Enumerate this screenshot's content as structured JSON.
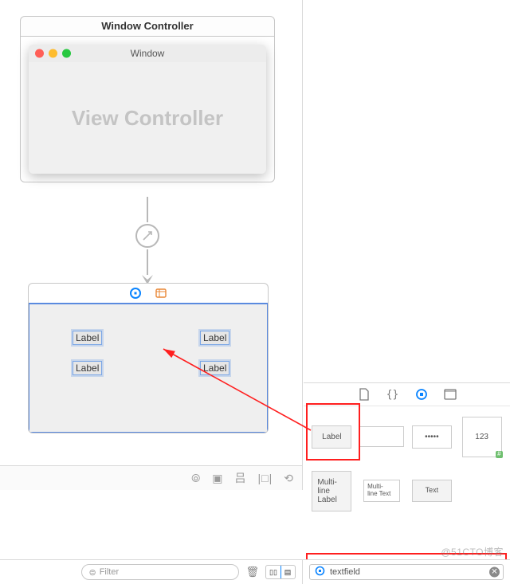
{
  "canvas": {
    "window_controller_title": "Window Controller",
    "window_title": "Window",
    "view_controller_placeholder": "View Controller",
    "dropped_labels": {
      "l1": "Label",
      "l2": "Label",
      "l3": "Label",
      "l4": "Label"
    }
  },
  "library": {
    "items": {
      "label": "Label",
      "password": "•••••",
      "number": "123",
      "multiline_label": "Multi-\nline\nLabel",
      "multiline_text": "Multi-\nline Text",
      "text": "Text"
    },
    "search_value": "textfield"
  },
  "bottom": {
    "filter_placeholder": "Filter"
  },
  "watermark": "@51CTO博客"
}
